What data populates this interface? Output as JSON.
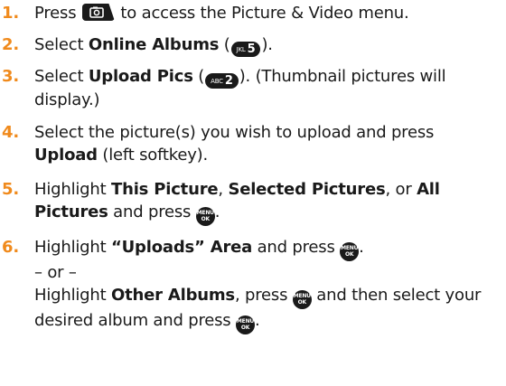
{
  "steps": [
    {
      "num": "1.",
      "t1": "Press ",
      "t2": " to access the Picture & Video menu."
    },
    {
      "num": "2.",
      "t1": "Select ",
      "b1": "Online Albums",
      "t2": " (",
      "t3": ")."
    },
    {
      "num": "3.",
      "t1": "Select ",
      "b1": "Upload Pics",
      "t2": " (",
      "t3": "). (Thumbnail pictures will display.)"
    },
    {
      "num": "4.",
      "t1": "Select the picture(s) you wish to upload and press ",
      "b1": "Upload",
      "t2": " (left softkey)."
    },
    {
      "num": "5.",
      "t1": "Highlight ",
      "b1": "This Picture",
      "t2": ", ",
      "b2": "Selected Pictures",
      "t3": ", or ",
      "b3": "All Pictures",
      "t4": " and press ",
      "t5": "."
    },
    {
      "num": "6.",
      "t1": "Highlight ",
      "b1": "“Uploads” Area",
      "t2": " and press ",
      "t3": ".",
      "or": "– or –",
      "t4": "Highlight ",
      "b2": "Other Albums",
      "t5": ", press ",
      "t6": " and then select your desired album and press ",
      "t7": "."
    }
  ],
  "keys": {
    "jkl5": {
      "small": "JKL",
      "big": "5"
    },
    "abc2": {
      "small": "ABC",
      "big": "2"
    },
    "menu_top": "MENU",
    "menu_bottom": "OK"
  },
  "icons": {
    "camera": "camera-key-icon",
    "menu_ok": "menu-ok-key-icon"
  },
  "colors": {
    "step_number": "#f08a1c",
    "key_background": "#1a1a1a"
  }
}
